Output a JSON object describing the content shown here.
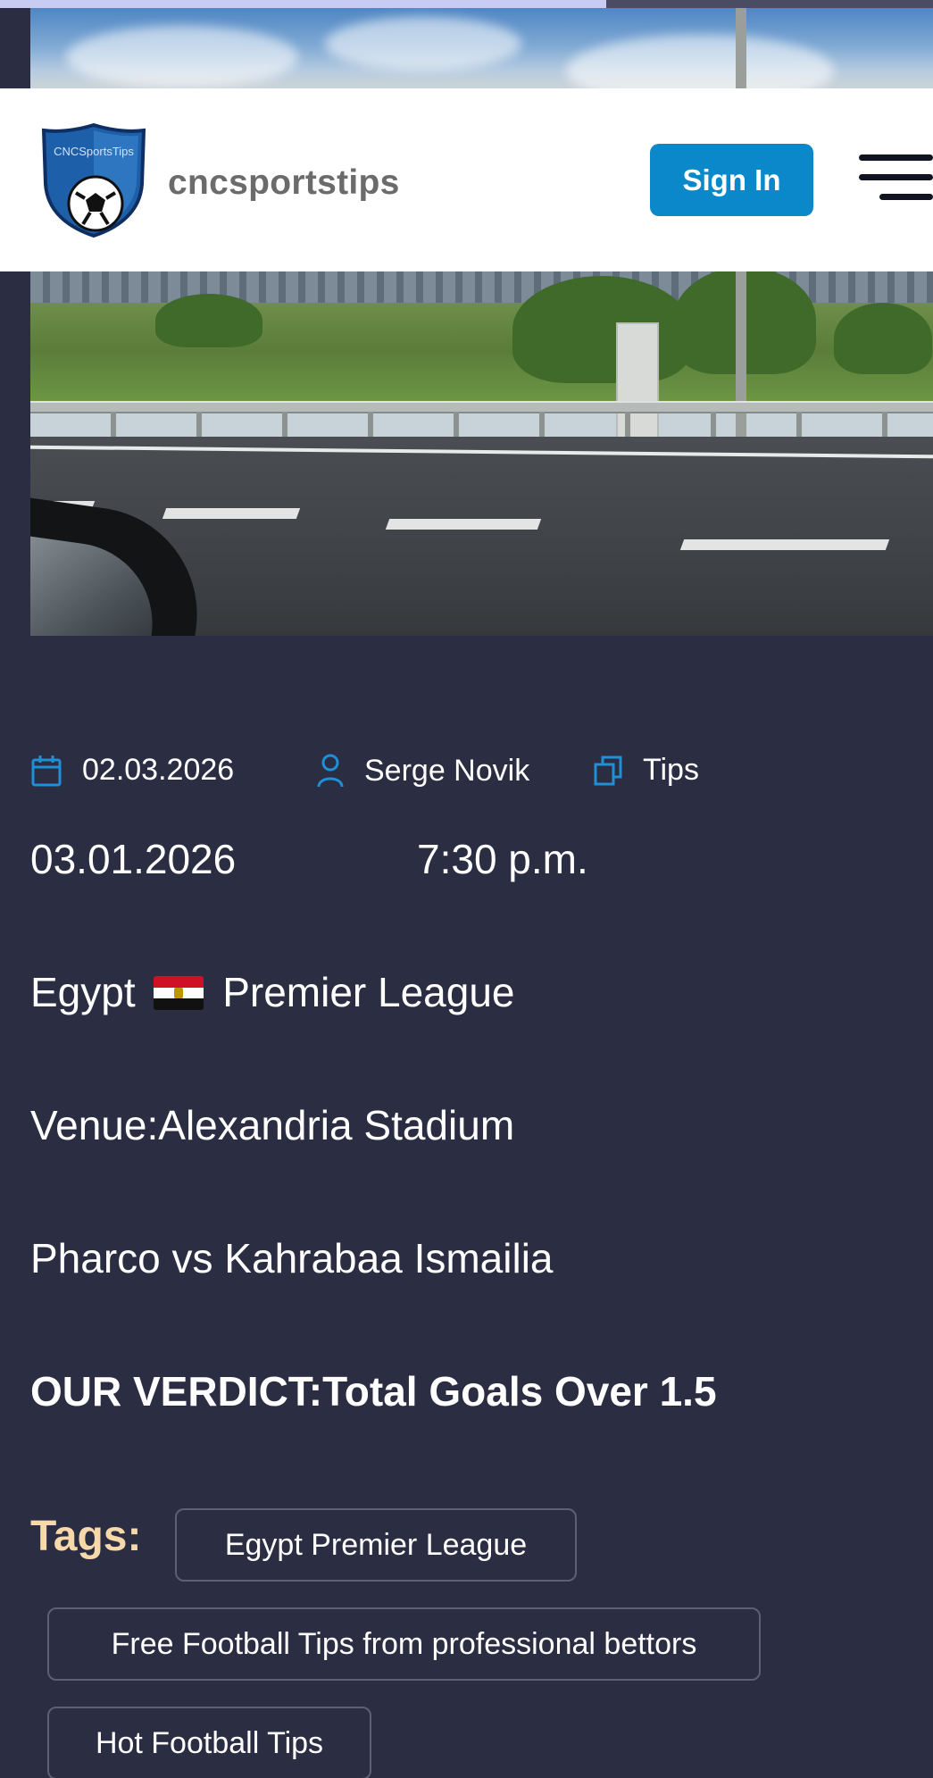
{
  "reading_progress": 0.65,
  "header": {
    "logo_text": "CNCSportsTips",
    "site_name": "cncsportstips",
    "sign_in_label": "Sign In"
  },
  "meta": {
    "date": "02.03.2026",
    "author": "Serge Novik",
    "category": "Tips"
  },
  "article": {
    "match_date": "03.01.2026",
    "match_time": "7:30 p.m.",
    "league_prefix": "Egypt",
    "league_suffix": "Premier League",
    "venue": "Venue:Alexandria Stadium",
    "teams": "Pharco vs Kahrabaa Ismailia",
    "verdict": "OUR VERDICT:Total Goals Over 1.5"
  },
  "tags": {
    "label": "Tags:",
    "items": [
      "Egypt Premier League",
      "Free Football Tips from professional bettors",
      "Hot Football Tips"
    ]
  },
  "colors": {
    "background": "#2b2d42",
    "accent": "#0a88c9",
    "tags_label": "#f7d8a8"
  },
  "icons": {
    "date": "calendar-icon",
    "author": "user-icon",
    "category": "copy-icon",
    "menu": "hamburger-menu-icon"
  }
}
